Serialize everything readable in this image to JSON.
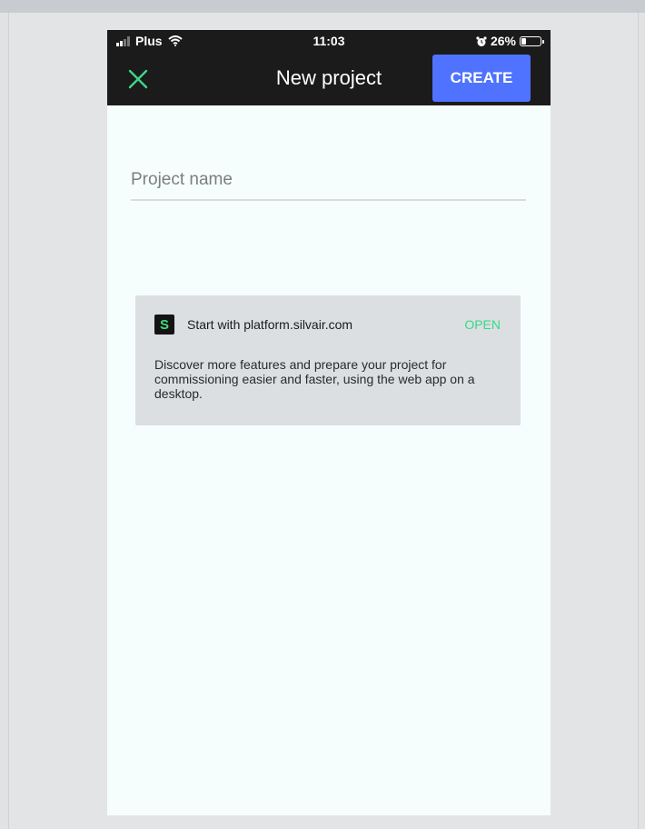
{
  "status_bar": {
    "carrier": "Plus",
    "time": "11:03",
    "battery_percent_text": "26%",
    "battery_level": 0.26
  },
  "app_bar": {
    "close_icon": "close-icon",
    "title": "New project",
    "create_label": "CREATE"
  },
  "form": {
    "project_name_placeholder": "Project name",
    "project_name_value": ""
  },
  "promo": {
    "logo_letter": "S",
    "title": "Start with platform.silvair.com",
    "open_label": "OPEN",
    "description": "Discover more features and prepare your project for commissioning easier and faster, using the web app on a desktop."
  },
  "colors": {
    "app_bar_bg": "#1b1b1b",
    "accent_blue": "#4f73ff",
    "close_green": "#3fd68c",
    "open_green": "#34d98a"
  }
}
